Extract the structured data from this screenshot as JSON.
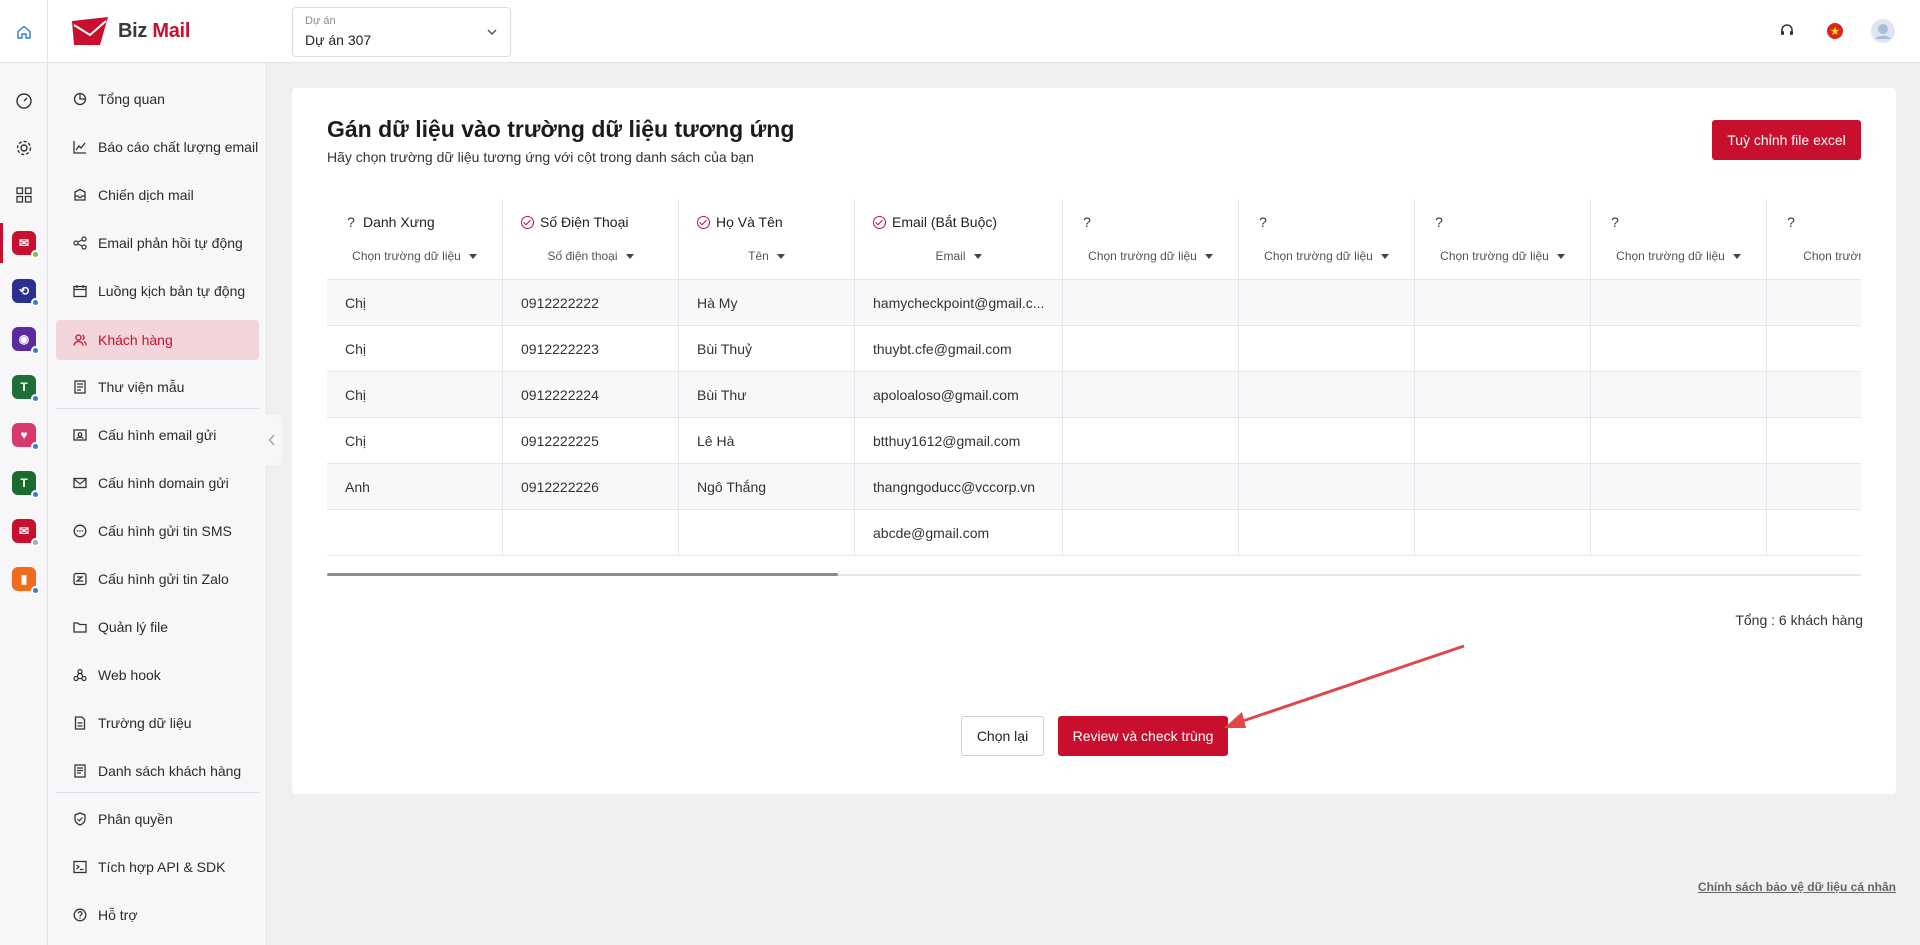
{
  "app": {
    "brand_prefix": "Biz",
    "brand_suffix": "Mail",
    "accent": "#c8102e"
  },
  "project": {
    "label": "Dự án",
    "value": "Dự án 307"
  },
  "sidebar": {
    "items": [
      {
        "label": "Tổng quan",
        "icon": "pie-chart-icon"
      },
      {
        "label": "Báo cáo chất lượng email",
        "icon": "line-chart-icon"
      },
      {
        "label": "Chiến dịch mail",
        "icon": "inbox-icon"
      },
      {
        "label": "Email phản hồi tự động",
        "icon": "share-nodes-icon"
      },
      {
        "label": "Luồng kịch bản tự động",
        "icon": "calendar-flow-icon"
      },
      {
        "label": "Khách hàng",
        "icon": "users-icon",
        "active": true
      },
      {
        "label": "Thư viện mẫu",
        "icon": "template-icon"
      },
      {
        "label": "Cấu hình email gửi",
        "icon": "email-config-icon"
      },
      {
        "label": "Cấu hình domain gửi",
        "icon": "envelope-icon"
      },
      {
        "label": "Cấu hình gửi tin SMS",
        "icon": "sms-icon"
      },
      {
        "label": "Cấu hình gửi tin Zalo",
        "icon": "zalo-icon"
      },
      {
        "label": "Quản lý file",
        "icon": "folder-icon"
      },
      {
        "label": "Web hook",
        "icon": "webhook-icon"
      },
      {
        "label": "Trường dữ liệu",
        "icon": "document-icon"
      },
      {
        "label": "Danh sách khách hàng",
        "icon": "list-icon"
      },
      {
        "label": "Phân quyền",
        "icon": "shield-check-icon"
      },
      {
        "label": "Tích hợp API & SDK",
        "icon": "terminal-icon"
      },
      {
        "label": "Hỗ trợ",
        "icon": "help-circle-icon"
      }
    ]
  },
  "main": {
    "title": "Gán dữ liệu vào trường dữ liệu tương ứng",
    "subtitle": "Hãy chọn trường dữ liệu tương ứng với cột trong danh sách của bạn",
    "excel_button": "Tuỳ chỉnh file excel",
    "columns": [
      {
        "title": "Danh Xưng",
        "mapped": false,
        "select": "Chọn trường dữ liệu",
        "cells": [
          "Chị",
          "Chị",
          "Chị",
          "Chị",
          "Anh",
          ""
        ]
      },
      {
        "title": "Số Điện Thoại",
        "mapped": true,
        "select": "Số điện thoại",
        "cells": [
          "0912222222",
          "0912222223",
          "0912222224",
          "0912222225",
          "0912222226",
          ""
        ]
      },
      {
        "title": "Họ Và Tên",
        "mapped": true,
        "select": "Tên",
        "cells": [
          "Hà My",
          "Bùi Thuỷ",
          "Bùi Thư",
          "Lê Hà",
          "Ngô Thắng",
          ""
        ]
      },
      {
        "title": "Email (Bắt Buộc)",
        "mapped": true,
        "select": "Email",
        "cells": [
          "hamycheckpoint@gmail.c...",
          "thuybt.cfe@gmail.com",
          "apoloaloso@gmail.com",
          "btthuy1612@gmail.com",
          "thangngoducc@vccorp.vn",
          "abcde@gmail.com"
        ]
      },
      {
        "title": "",
        "mapped": false,
        "select": "Chọn trường dữ liệu",
        "cells": [
          "",
          "",
          "",
          "",
          "",
          ""
        ]
      },
      {
        "title": "",
        "mapped": false,
        "select": "Chọn trường dữ liệu",
        "cells": [
          "",
          "",
          "",
          "",
          "",
          ""
        ]
      },
      {
        "title": "",
        "mapped": false,
        "select": "Chọn trường dữ liệu",
        "cells": [
          "",
          "",
          "",
          "",
          "",
          ""
        ]
      },
      {
        "title": "",
        "mapped": false,
        "select": "Chọn trường dữ liệu",
        "cells": [
          "",
          "",
          "",
          "",
          "",
          ""
        ]
      },
      {
        "title": "",
        "mapped": false,
        "select": "Chọn trường dữ",
        "cells": [
          "",
          "",
          "",
          "",
          "",
          ""
        ]
      }
    ],
    "total": "Tổng : 6 khách hàng",
    "reset_button": "Chọn lại",
    "review_button": "Review và check trùng"
  },
  "footer": {
    "privacy_link": "Chính sách bảo vệ dữ liệu cá nhân"
  }
}
